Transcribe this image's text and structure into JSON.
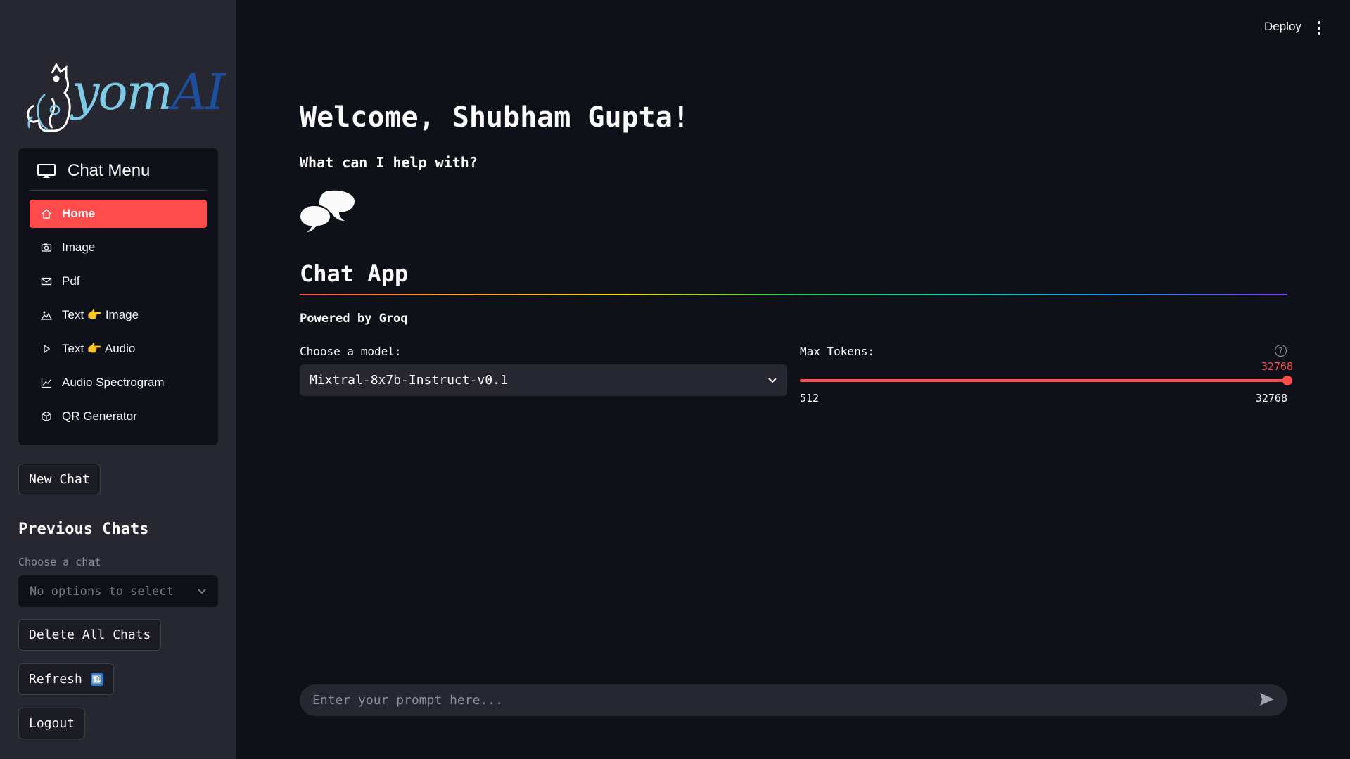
{
  "header": {
    "deploy_label": "Deploy",
    "menu_icon": "kebab-menu-icon"
  },
  "sidebar": {
    "logo": {
      "part1": "yom",
      "part2": "AI",
      "icon": "cat-mascot-icon"
    },
    "menu": {
      "title": "Chat Menu",
      "items": [
        {
          "label": "Home",
          "icon": "home-icon",
          "active": true
        },
        {
          "label": "Image",
          "icon": "camera-icon"
        },
        {
          "label": "Pdf",
          "icon": "envelope-icon"
        },
        {
          "label": "Text",
          "thumb": "👉",
          "label2": "Image",
          "icon": "landscape-icon"
        },
        {
          "label": "Text",
          "thumb": "👉",
          "label2": "Audio",
          "icon": "play-icon"
        },
        {
          "label": "Audio Spectrogram",
          "icon": "graph-icon"
        },
        {
          "label": "QR Generator",
          "icon": "box-icon"
        }
      ]
    },
    "new_chat": "New Chat",
    "previous_chats": {
      "title": "Previous Chats",
      "choose_label": "Choose a chat",
      "placeholder": "No options to select"
    },
    "delete_all": "Delete All Chats",
    "refresh": "Refresh",
    "refresh_icon": "🔃",
    "logout": "Logout"
  },
  "main": {
    "welcome": "Welcome, Shubham Gupta!",
    "help": "What can I help with?",
    "chat_icon": "speech-bubbles-icon",
    "app_title": "Chat App",
    "powered_by": "Powered by Groq",
    "model": {
      "label": "Choose a model:",
      "selected": "Mixtral-8x7b-Instruct-v0.1"
    },
    "max_tokens": {
      "label": "Max Tokens:",
      "value": "32768",
      "min": "512",
      "max": "32768",
      "fraction": 1.0
    },
    "prompt_placeholder": "Enter your prompt here..."
  },
  "colors": {
    "accent": "#ff4b4b",
    "sidebar_bg": "#262730",
    "main_bg": "#0e1117"
  }
}
